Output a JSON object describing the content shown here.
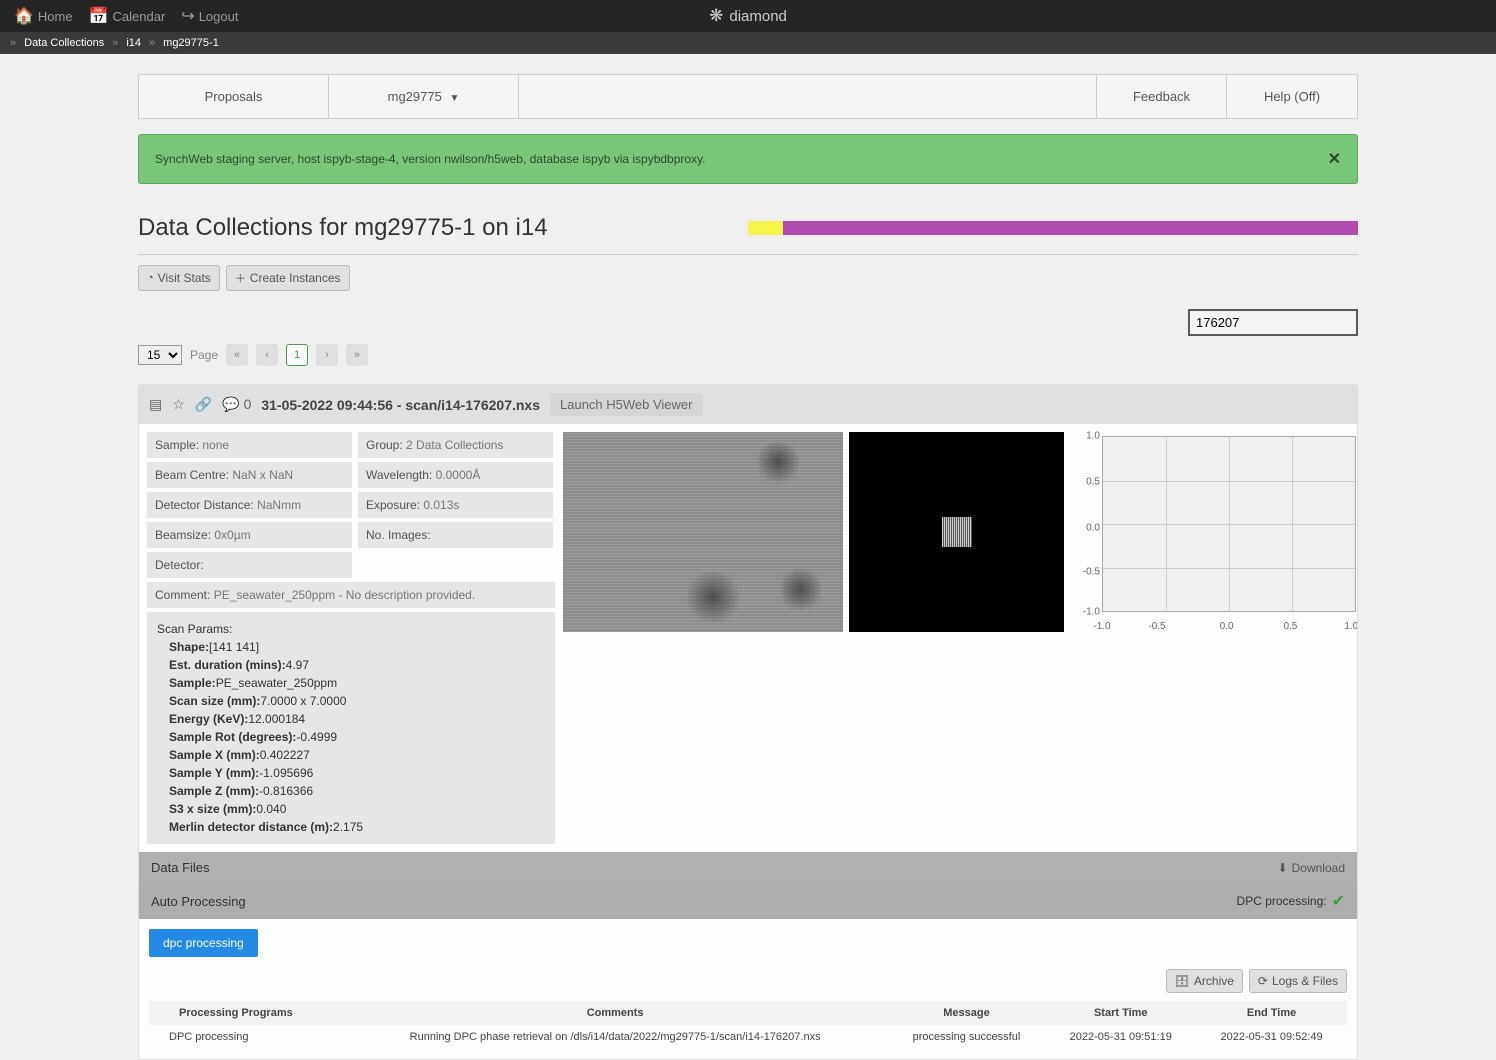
{
  "topnav": {
    "home": "Home",
    "calendar": "Calendar",
    "logout": "Logout",
    "brand": "diamond"
  },
  "breadcrumb": [
    "Data Collections",
    "i14",
    "mg29775-1"
  ],
  "tabs": {
    "proposals": "Proposals",
    "proposal_code": "mg29775",
    "feedback": "Feedback",
    "help": "Help (Off)"
  },
  "banner": {
    "text": "SynchWeb staging server, host ispyb-stage-4, version nwilson/h5web, database ispyb via ispybdbproxy."
  },
  "page_title": "Data Collections for mg29775-1 on i14",
  "toolbar": {
    "visit_stats": "Visit Stats",
    "create_instances": "Create Instances"
  },
  "search": {
    "value": "176207"
  },
  "pagination": {
    "page_size": "15",
    "options": [
      "15"
    ],
    "page_label": "Page",
    "current_page": "1"
  },
  "dc": {
    "comments_count": "0",
    "title": "31-05-2022 09:44:56 - scan/i14-176207.nxs",
    "launch_btn": "Launch H5Web Viewer",
    "sample": {
      "lbl": "Sample:",
      "val": "none"
    },
    "beam_centre": {
      "lbl": "Beam Centre:",
      "val": "NaN x NaN"
    },
    "detector_distance": {
      "lbl": "Detector Distance:",
      "val": "NaNmm"
    },
    "beamsize": {
      "lbl": "Beamsize:",
      "val": "0x0µm"
    },
    "detector": {
      "lbl": "Detector:",
      "val": ""
    },
    "comment": {
      "lbl": "Comment:",
      "val": "PE_seawater_250ppm - No description provided."
    },
    "group": {
      "lbl": "Group:",
      "val": "2 Data Collections"
    },
    "wavelength": {
      "lbl": "Wavelength:",
      "val": "0.0000Å"
    },
    "exposure": {
      "lbl": "Exposure:",
      "val": "0.013s"
    },
    "no_images": {
      "lbl": "No. Images:",
      "val": ""
    },
    "scan_params": {
      "header": "Scan Params:",
      "lines": [
        {
          "k": "Shape:",
          "v": "[141 141]"
        },
        {
          "k": "Est. duration (mins):",
          "v": "4.97"
        },
        {
          "k": "Sample:",
          "v": "PE_seawater_250ppm"
        },
        {
          "k": "Scan size (mm):",
          "v": "7.0000 x 7.0000"
        },
        {
          "k": "Energy (KeV):",
          "v": "12.000184"
        },
        {
          "k": "Sample Rot (degrees):",
          "v": "-0.4999"
        },
        {
          "k": "Sample X (mm):",
          "v": "0.402227"
        },
        {
          "k": "Sample Y (mm):",
          "v": "-1.095696"
        },
        {
          "k": "Sample Z (mm):",
          "v": "-0.816366"
        },
        {
          "k": "S3 x size (mm):",
          "v": "0.040"
        },
        {
          "k": "Merlin detector distance (m):",
          "v": "2.175"
        }
      ]
    }
  },
  "chart_data": {
    "type": "scatter",
    "x": [],
    "y": [],
    "xlim": [
      -1.0,
      1.0
    ],
    "ylim": [
      -1.0,
      1.0
    ],
    "xticks": [
      "-1.0",
      "-0.5",
      "0.0",
      "0.5",
      "1.0"
    ],
    "yticks": [
      "-1.0",
      "-0.5",
      "0.0",
      "0.5",
      "1.0"
    ]
  },
  "data_files": {
    "title": "Data Files",
    "download": "Download"
  },
  "auto_processing": {
    "title": "Auto Processing",
    "status_label": "DPC processing:"
  },
  "proc_tab": "dpc processing",
  "proc_actions": {
    "archive": "Archive",
    "logs_files": "Logs & Files"
  },
  "proc_table": {
    "headers": [
      "Processing Programs",
      "Comments",
      "Message",
      "Start Time",
      "End Time"
    ],
    "row": {
      "program": "DPC processing",
      "comments": "Running DPC phase retrieval on /dls/i14/data/2022/mg29775-1/scan/i14-176207.nxs",
      "message": "processing successful",
      "start": "2022-05-31 09:51:19",
      "end": "2022-05-31 09:52:49"
    }
  }
}
